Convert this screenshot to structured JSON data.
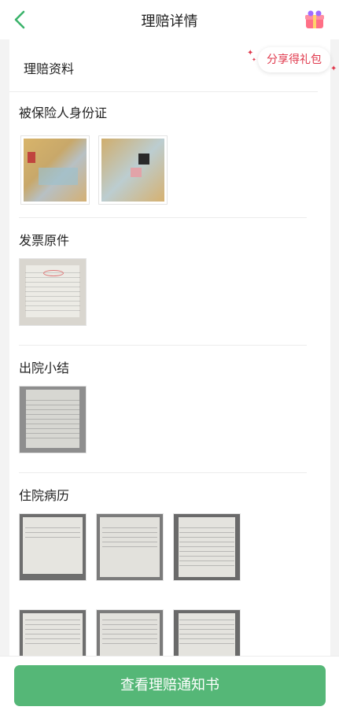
{
  "header": {
    "title": "理赔详情"
  },
  "share": {
    "label": "分享得礼包"
  },
  "sections": {
    "claim_docs": "理赔资料",
    "id_card": "被保险人身份证",
    "invoice": "发票原件",
    "discharge": "出院小结",
    "records": "住院病历"
  },
  "footer": {
    "button_label": "查看理赔通知书"
  },
  "colors": {
    "accent": "#55b777",
    "share": "#e0384c"
  }
}
